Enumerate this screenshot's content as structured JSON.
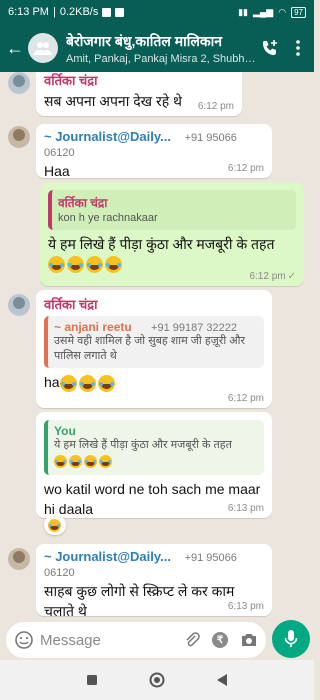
{
  "status_bar": {
    "time": "6:13 PM",
    "network_speed": "0.2KB/s",
    "battery": "97"
  },
  "header": {
    "group_name": "बेरोजगार बंधु,कातिल मालिकान",
    "participants": "Amit, Pankaj, Pankaj Misra 2, Shubh L..."
  },
  "messages": [
    {
      "sender": "वर्तिका चंद्रा",
      "text": "सब अपना अपना देख रहे थे",
      "time": "6:12 pm"
    },
    {
      "sender": "~ Journalist@Daily...",
      "phone": "+91 95066 06120",
      "text": "Haa",
      "time": "6:12 pm"
    },
    {
      "quote_sender": "वर्तिका चंद्रा",
      "quote_text": "kon h ye rachnakaar",
      "text": "ये हम लिखे हैं पीड़ा कुंठा और मजबूरी के तहत",
      "time": "6:12 pm",
      "status": "✓"
    },
    {
      "sender": "वर्तिका चंद्रा",
      "quote_sender": "~ anjani reetu",
      "quote_phone": "+91 99187 32222",
      "quote_text": "उसमे वही शामिल है जो सुबह शाम जी हज़ूरी और पालिस लगाते थे",
      "text": "ha",
      "time": "6:12 pm"
    },
    {
      "quote_sender": "You",
      "quote_text": "ये हम लिखे हैं पीड़ा कुंठा और मजबूरी के तहत",
      "text": "wo katil word ne toh sach me maar hi daala",
      "time": "6:13 pm"
    },
    {
      "sender": "~ Journalist@Daily...",
      "phone": "+91 95066 06120",
      "text": "साहब कुछ लोगो से स्क्रिप्ट ले कर काम चलाते थे",
      "time": "6:13 pm"
    }
  ],
  "composer": {
    "placeholder": "Message"
  },
  "colors": {
    "header": "#075e54",
    "chat_bg": "#ece5dd",
    "outgoing": "#dcf8c6",
    "accent": "#00a884"
  }
}
